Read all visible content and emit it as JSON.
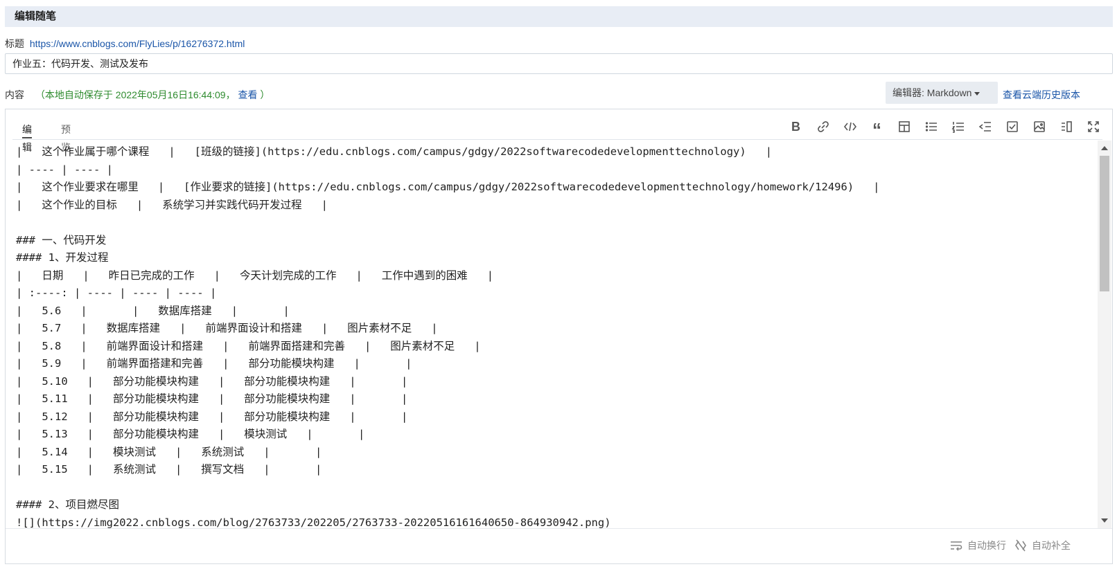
{
  "header": {
    "title": "编辑随笔"
  },
  "title_field": {
    "label": "标题",
    "url": "https://www.cnblogs.com/FlyLies/p/16276372.html",
    "value": "作业五：代码开发、测试及发布"
  },
  "content_field": {
    "label": "内容",
    "autosave": "（本地自动保存于 2022年05月16日16:44:09，",
    "view_label": "查看",
    "autosave_end": "）"
  },
  "editor_select": {
    "label": "编辑器: Markdown"
  },
  "cloud_history": {
    "label": "查看云端历史版本"
  },
  "tabs": [
    {
      "label": "编辑",
      "active": true
    },
    {
      "label": "预览",
      "active": false
    }
  ],
  "toolbar": {
    "icons": [
      "bold-icon",
      "link-icon",
      "code-icon",
      "quote-icon",
      "table-icon",
      "bullet-list-icon",
      "ordered-list-icon",
      "outdent-icon",
      "checkbox-icon",
      "image-icon",
      "side-by-side-icon",
      "fullscreen-icon"
    ]
  },
  "code_lines": [
    "|   这个作业属于哪个课程   |   [班级的链接](https://edu.cnblogs.com/campus/gdgy/2022softwarecodedevelopmenttechnology)   |",
    "| ---- | ---- |",
    "|   这个作业要求在哪里   |   [作业要求的链接](https://edu.cnblogs.com/campus/gdgy/2022softwarecodedevelopmenttechnology/homework/12496)   |",
    "|   这个作业的目标   |   系统学习并实践代码开发过程   |",
    "",
    "### 一、代码开发",
    "#### 1、开发过程",
    "|   日期   |   昨日已完成的工作   |   今天计划完成的工作   |   工作中遇到的困难   |",
    "| :----: | ---- | ---- | ---- |",
    "|   5.6   |       |   数据库搭建   |       |",
    "|   5.7   |   数据库搭建   |   前端界面设计和搭建   |   图片素材不足   |",
    "|   5.8   |   前端界面设计和搭建   |   前端界面搭建和完善   |   图片素材不足   |",
    "|   5.9   |   前端界面搭建和完善   |   部分功能模块构建   |       |",
    "|   5.10   |   部分功能模块构建   |   部分功能模块构建   |       |",
    "|   5.11   |   部分功能模块构建   |   部分功能模块构建   |       |",
    "|   5.12   |   部分功能模块构建   |   部分功能模块构建   |       |",
    "|   5.13   |   部分功能模块构建   |   模块测试   |       |",
    "|   5.14   |   模块测试   |   系统测试   |       |",
    "|   5.15   |   系统测试   |   撰写文档   |       |",
    "",
    "#### 2、项目燃尽图",
    "![](https://img2022.cnblogs.com/blog/2763733/202205/2763733-20220516161640650-864930942.png)"
  ],
  "footer": {
    "word_wrap": "自动换行",
    "auto_complete": "自动补全"
  }
}
